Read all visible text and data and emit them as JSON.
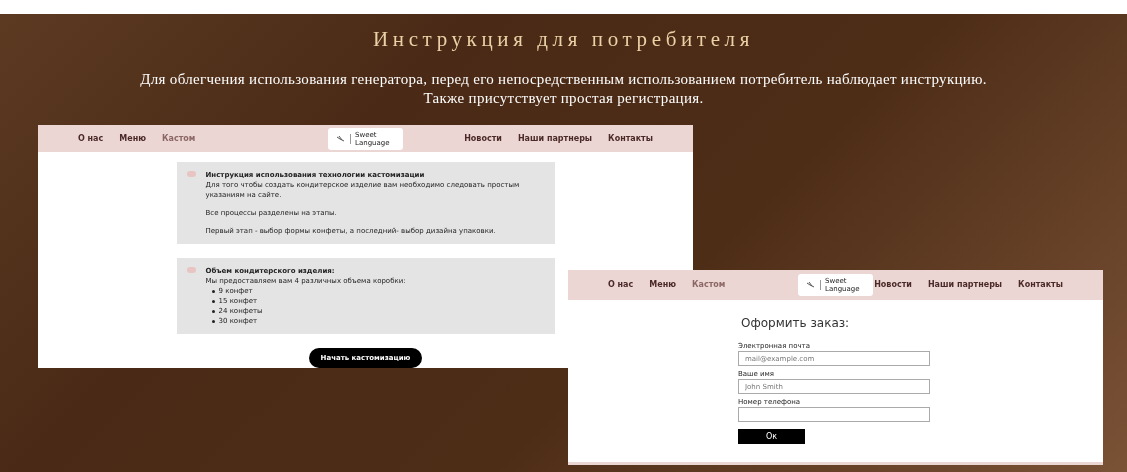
{
  "slide": {
    "title": "Инструкция для потребителя",
    "description": [
      "Для облегчения использования генератора, перед его непосредственным использованием  потребитель наблюдает инструкцию.",
      "Также присутствует простая регистрация."
    ]
  },
  "customization_page": {
    "header": {
      "nav_left": [
        {
          "label": "О нас",
          "selected": false
        },
        {
          "label": "Меню",
          "selected": false
        },
        {
          "label": "Кастом",
          "selected": true
        }
      ],
      "logo": "Sweet Language",
      "nav_right": [
        {
          "label": "Новости",
          "selected": false
        },
        {
          "label": "Наши партнеры",
          "selected": false
        },
        {
          "label": "Контакты",
          "selected": false
        }
      ]
    },
    "cards": [
      {
        "heading": "Инструкция использования технологии кастомизации",
        "paragraphs": [
          "Для того чтобы создать кондитерское изделие вам необходимо следовать простым указаниям на сайте.",
          "Все процессы разделены на этапы.",
          "Первый этап - выбор формы конфеты, а последний- выбор дизайна упаковки."
        ]
      },
      {
        "heading": "Объем кондитерского изделия:",
        "paragraphs": [
          "Мы предоставляем вам 4 различных объема коробки:"
        ],
        "list": [
          "9 конфет",
          "15 конфет",
          "24 конфеты",
          "30 конфет"
        ]
      }
    ],
    "button": "Начать кастомизацию"
  },
  "order_page": {
    "header": {
      "nav_left": [
        {
          "label": "О нас",
          "selected": false
        },
        {
          "label": "Меню",
          "selected": false
        },
        {
          "label": "Кастом",
          "selected": true
        }
      ],
      "logo": "Sweet Language",
      "nav_right": [
        {
          "label": "Новости",
          "selected": false
        },
        {
          "label": "Наши партнеры",
          "selected": false
        },
        {
          "label": "Контакты",
          "selected": false
        }
      ]
    },
    "title": "Оформить заказ:",
    "fields": [
      {
        "label": "Электронная почта",
        "placeholder": "mail@example.com"
      },
      {
        "label": "Ваше имя",
        "placeholder": "John Smith"
      },
      {
        "label": "Номер телефона"
      }
    ],
    "button": "Ок"
  }
}
